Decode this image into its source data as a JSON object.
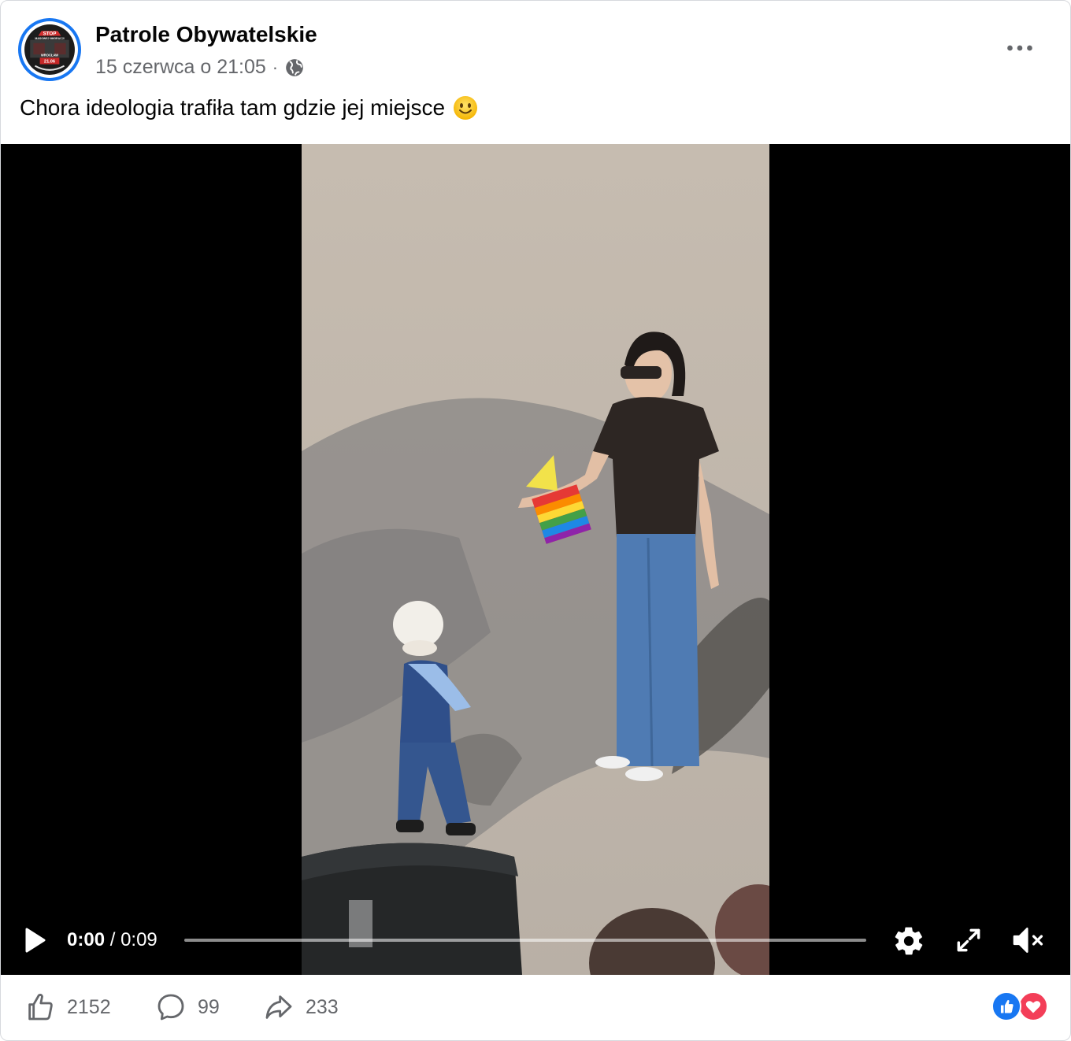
{
  "post": {
    "page_name": "Patrole Obywatelskie",
    "timestamp": "15 czerwca o 21:05",
    "separator": "·",
    "audience_icon": "globe-icon",
    "text": "Chora ideologia trafiła tam gdzie jej miejsce",
    "emoji": "slightly-smiling-face"
  },
  "avatar": {
    "lines": [
      "STOP",
      "MASOWEJ IMIGRACJI",
      "WROCŁAW",
      "21.06"
    ]
  },
  "video": {
    "current_time": "0:00",
    "separator": " / ",
    "duration": "0:09",
    "progress": 0,
    "muted": true,
    "icons": [
      "play-icon",
      "settings-gear-icon",
      "fullscreen-icon",
      "muted-speaker-icon"
    ]
  },
  "footer": {
    "likes": "2152",
    "comments": "99",
    "shares": "233",
    "reactions": [
      "like",
      "love"
    ]
  },
  "colors": {
    "brand_blue": "#1877f2",
    "love_red": "#f33e58",
    "secondary_text": "#65676b"
  }
}
